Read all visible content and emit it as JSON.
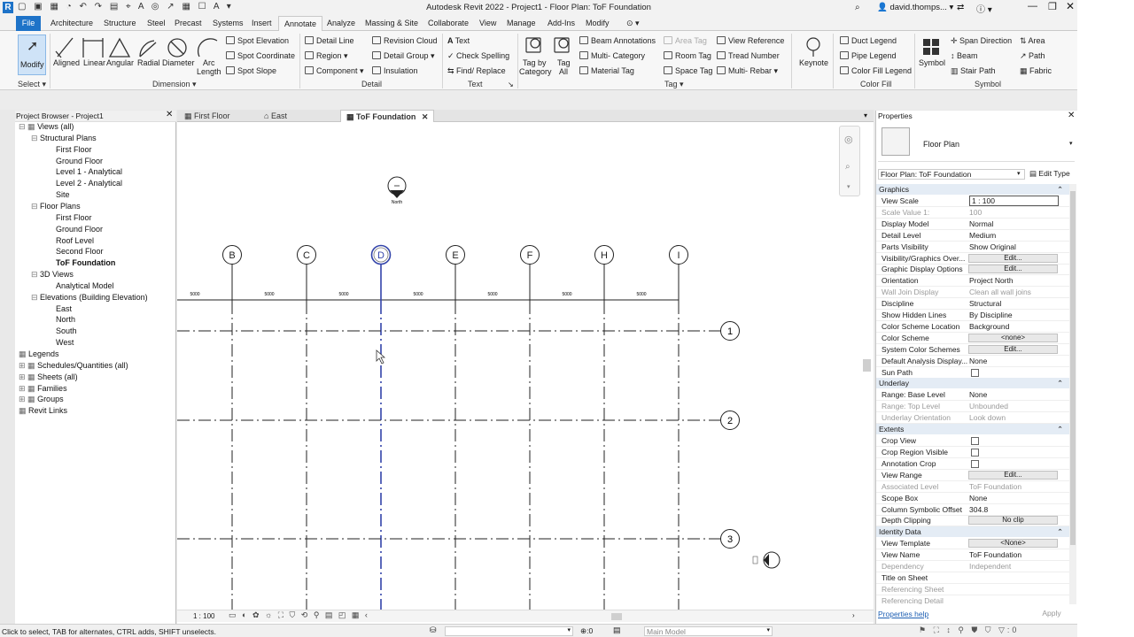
{
  "app": {
    "title": "Autodesk Revit 2022 - Project1 - Floor Plan: ToF Foundation",
    "user": "david.thomps...",
    "search_icon": "binoculars-icon"
  },
  "ribbon_tabs": [
    "File",
    "Architecture",
    "Structure",
    "Steel",
    "Precast",
    "Systems",
    "Insert",
    "Annotate",
    "Analyze",
    "Massing & Site",
    "Collaborate",
    "View",
    "Manage",
    "Add-Ins",
    "Modify"
  ],
  "active_tab": "Annotate",
  "ribbon": {
    "select": {
      "modify": "Modify",
      "panel": "Select"
    },
    "dimension": {
      "aligned": "Aligned",
      "linear": "Linear",
      "angular": "Angular",
      "radial": "Radial",
      "diameter": "Diameter",
      "arc1": "Arc",
      "arc2": "Length",
      "spot_elevation": "Spot Elevation",
      "spot_coordinate": "Spot Coordinate",
      "spot_slope": "Spot Slope",
      "panel": "Dimension"
    },
    "detail": {
      "detail_line": "Detail Line",
      "region": "Region",
      "component": "Component",
      "revision_cloud": "Revision Cloud",
      "detail_group": "Detail Group",
      "insulation": "Insulation",
      "panel": "Detail"
    },
    "text": {
      "text": "Text",
      "check_spelling": "Check Spelling",
      "find_replace": "Find/ Replace",
      "panel": "Text"
    },
    "tag": {
      "tag_by_category_1": "Tag by",
      "tag_by_category_2": "Category",
      "tag_all_1": "Tag",
      "tag_all_2": "All",
      "beam_annotations": "Beam Annotations",
      "multi_category": "Multi- Category",
      "material_tag": "Material Tag",
      "area_tag": "Area Tag",
      "room_tag": "Room Tag",
      "space_tag": "Space Tag",
      "view_reference": "View Reference",
      "tread_number": "Tread Number",
      "multi_rebar": "Multi- Rebar",
      "panel": "Tag"
    },
    "keynote": "Keynote",
    "color_fill": {
      "duct_legend": "Duct Legend",
      "pipe_legend": "Pipe Legend",
      "color_fill_legend": "Color Fill Legend",
      "panel": "Color Fill"
    },
    "symbol": {
      "symbol": "Symbol",
      "span_direction": "Span Direction",
      "beam": "Beam",
      "stair_path": "Stair Path",
      "area": "Area",
      "path": "Path",
      "fabric": "Fabric",
      "panel": "Symbol"
    }
  },
  "project_browser": {
    "title": "Project Browser - Project1",
    "items": [
      {
        "label": "Views (all)",
        "level": 0
      },
      {
        "label": "Structural Plans",
        "level": 1
      },
      {
        "label": "First Floor",
        "level": 2
      },
      {
        "label": "Ground Floor",
        "level": 2
      },
      {
        "label": "Level 1 - Analytical",
        "level": 2
      },
      {
        "label": "Level 2 - Analytical",
        "level": 2
      },
      {
        "label": "Site",
        "level": 2
      },
      {
        "label": "Floor Plans",
        "level": 1
      },
      {
        "label": "First Floor",
        "level": 2
      },
      {
        "label": "Ground Floor",
        "level": 2
      },
      {
        "label": "Roof Level",
        "level": 2
      },
      {
        "label": "Second Floor",
        "level": 2
      },
      {
        "label": "ToF Foundation",
        "level": 2
      },
      {
        "label": "3D Views",
        "level": 1
      },
      {
        "label": "Analytical Model",
        "level": 2
      },
      {
        "label": "Elevations (Building Elevation)",
        "level": 1
      },
      {
        "label": "East",
        "level": 2
      },
      {
        "label": "North",
        "level": 2
      },
      {
        "label": "South",
        "level": 2
      },
      {
        "label": "West",
        "level": 2
      },
      {
        "label": "Legends",
        "level": 0
      },
      {
        "label": "Schedules/Quantities (all)",
        "level": 0
      },
      {
        "label": "Sheets (all)",
        "level": 0
      },
      {
        "label": "Families",
        "level": 0
      },
      {
        "label": "Groups",
        "level": 0
      },
      {
        "label": "Revit Links",
        "level": 0
      }
    ]
  },
  "doc_tabs": [
    {
      "label": "First Floor"
    },
    {
      "label": "East"
    },
    {
      "label": "ToF Foundation",
      "active": true
    }
  ],
  "drawing": {
    "north_label": "North",
    "grid_columns": [
      "B",
      "C",
      "D",
      "E",
      "F",
      "H",
      "I"
    ],
    "grid_rows": [
      "1",
      "2",
      "3"
    ],
    "dim_values": [
      "5000",
      "5000",
      "5000",
      "5000",
      "5000",
      "5000",
      "5000"
    ],
    "selected_grid": "D"
  },
  "view_control": {
    "scale": "1 : 100"
  },
  "properties": {
    "title": "Properties",
    "type_name": "Floor Plan",
    "selector": "Floor Plan: ToF Foundation",
    "edit_type": "Edit Type",
    "sections": [
      {
        "name": "Graphics",
        "rows": [
          {
            "k": "View Scale",
            "v": "1 : 100",
            "kind": "input"
          },
          {
            "k": "Scale Value    1:",
            "v": "100",
            "kind": "grey"
          },
          {
            "k": "Display Model",
            "v": "Normal"
          },
          {
            "k": "Detail Level",
            "v": "Medium"
          },
          {
            "k": "Parts Visibility",
            "v": "Show Original"
          },
          {
            "k": "Visibility/Graphics Over...",
            "v": "Edit...",
            "kind": "button"
          },
          {
            "k": "Graphic Display Options",
            "v": "Edit...",
            "kind": "button"
          },
          {
            "k": "Orientation",
            "v": "Project North"
          },
          {
            "k": "Wall Join Display",
            "v": "Clean all wall joins",
            "kind": "grey"
          },
          {
            "k": "Discipline",
            "v": "Structural"
          },
          {
            "k": "Show Hidden Lines",
            "v": "By Discipline"
          },
          {
            "k": "Color Scheme Location",
            "v": "Background"
          },
          {
            "k": "Color Scheme",
            "v": "<none>",
            "kind": "button"
          },
          {
            "k": "System Color Schemes",
            "v": "Edit...",
            "kind": "button"
          },
          {
            "k": "Default Analysis Display...",
            "v": "None"
          },
          {
            "k": "Sun Path",
            "v": "",
            "kind": "check"
          }
        ]
      },
      {
        "name": "Underlay",
        "rows": [
          {
            "k": "Range: Base Level",
            "v": "None"
          },
          {
            "k": "Range: Top Level",
            "v": "Unbounded",
            "kind": "grey"
          },
          {
            "k": "Underlay Orientation",
            "v": "Look down",
            "kind": "grey"
          }
        ]
      },
      {
        "name": "Extents",
        "rows": [
          {
            "k": "Crop View",
            "v": "",
            "kind": "check"
          },
          {
            "k": "Crop Region Visible",
            "v": "",
            "kind": "check"
          },
          {
            "k": "Annotation Crop",
            "v": "",
            "kind": "check"
          },
          {
            "k": "View Range",
            "v": "Edit...",
            "kind": "button"
          },
          {
            "k": "Associated Level",
            "v": "ToF Foundation",
            "kind": "grey"
          },
          {
            "k": "Scope Box",
            "v": "None"
          },
          {
            "k": "Column Symbolic Offset",
            "v": "304.8"
          },
          {
            "k": "Depth Clipping",
            "v": "No clip",
            "kind": "button"
          }
        ]
      },
      {
        "name": "Identity Data",
        "rows": [
          {
            "k": "View Template",
            "v": "<None>",
            "kind": "button"
          },
          {
            "k": "View Name",
            "v": "ToF Foundation"
          },
          {
            "k": "Dependency",
            "v": "Independent",
            "kind": "grey"
          },
          {
            "k": "Title on Sheet",
            "v": ""
          },
          {
            "k": "Referencing Sheet",
            "v": "",
            "kind": "grey"
          },
          {
            "k": "Referencing Detail",
            "v": "",
            "kind": "grey"
          }
        ]
      }
    ],
    "help": "Properties help",
    "apply": "Apply"
  },
  "status": {
    "hint": "Click to select, TAB for alternates, CTRL adds, SHIFT unselects.",
    "zero": ":0",
    "model": "Main Model"
  },
  "colors": {
    "accent": "#1e73c8",
    "selected_grid": "#3344aa"
  }
}
